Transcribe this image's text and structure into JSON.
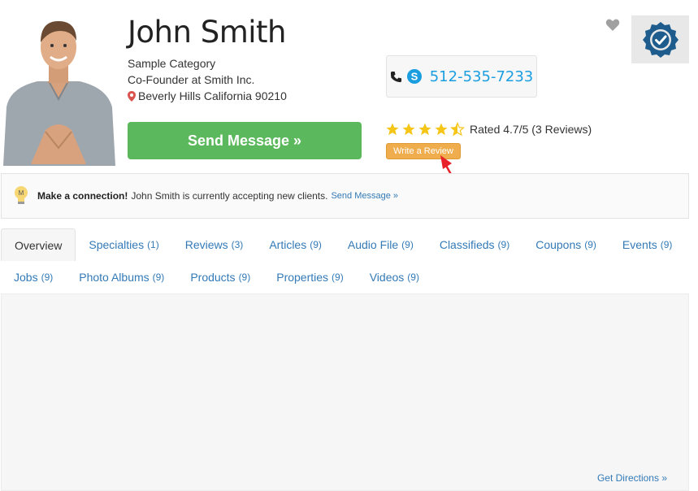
{
  "profile": {
    "name": "John Smith",
    "category": "Sample Category",
    "title": "Co-Founder at Smith Inc.",
    "location": "Beverly Hills California 90210"
  },
  "actions": {
    "send_message": "Send Message »",
    "write_review": "Write a Review"
  },
  "contact": {
    "phone": "512-535-7233"
  },
  "rating": {
    "stars": 4.7,
    "text": "Rated 4.7/5 (3 Reviews)"
  },
  "connection": {
    "lead": "Make a connection!",
    "message": "John Smith is currently accepting new clients.",
    "link": "Send Message »"
  },
  "tabs_row1": [
    {
      "label": "Overview",
      "count": ""
    },
    {
      "label": "Specialties",
      "count": "(1)"
    },
    {
      "label": "Reviews",
      "count": "(3)"
    },
    {
      "label": "Articles",
      "count": "(9)"
    },
    {
      "label": "Audio File",
      "count": "(9)"
    },
    {
      "label": "Classifieds",
      "count": "(9)"
    },
    {
      "label": "Coupons",
      "count": "(9)"
    },
    {
      "label": "Events",
      "count": "(9)"
    }
  ],
  "tabs_row2": [
    {
      "label": "Jobs",
      "count": "(9)"
    },
    {
      "label": "Photo Albums",
      "count": "(9)"
    },
    {
      "label": "Products",
      "count": "(9)"
    },
    {
      "label": "Properties",
      "count": "(9)"
    },
    {
      "label": "Videos",
      "count": "(9)"
    }
  ],
  "footer": {
    "directions": "Get Directions »"
  },
  "colors": {
    "send_button": "#5cb85c",
    "review_button": "#f0ad4e",
    "phone": "#1a9ee0",
    "link": "#337ab7",
    "star": "#f5c518",
    "badge": "#1d5c8c",
    "arrow": "#e8202a"
  },
  "icons": [
    "profile-photo",
    "map-pin-icon",
    "phone-icon",
    "skype-icon",
    "star-icon",
    "heart-icon",
    "verified-badge-icon",
    "lightbulb-icon"
  ]
}
